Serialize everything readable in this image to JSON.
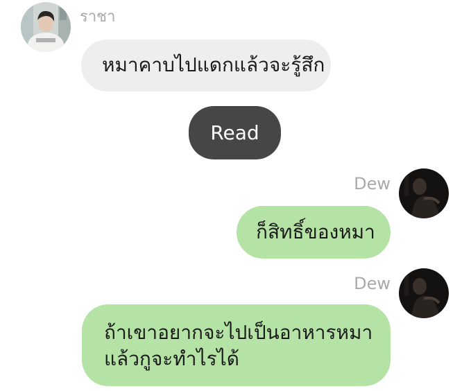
{
  "messages": [
    {
      "sender": "ราชา",
      "lines": [
        "หมาคาบไปแดกแล้วจะรู้สึก"
      ]
    },
    {
      "status": "Read"
    },
    {
      "sender": "Dew",
      "lines": [
        "ก็สิทธิ์ของหมา"
      ]
    },
    {
      "sender": "Dew",
      "lines": [
        "ถ้าเขาอยากจะไปเป็นอาหารหมา",
        "แล้วกูจะทำไรได้"
      ]
    }
  ],
  "colors": {
    "incoming_bubble": "#eeeeee",
    "outgoing_bubble": "#b5e3a5",
    "read_pill": "#464646",
    "sender_name": "#a9a9a9"
  }
}
